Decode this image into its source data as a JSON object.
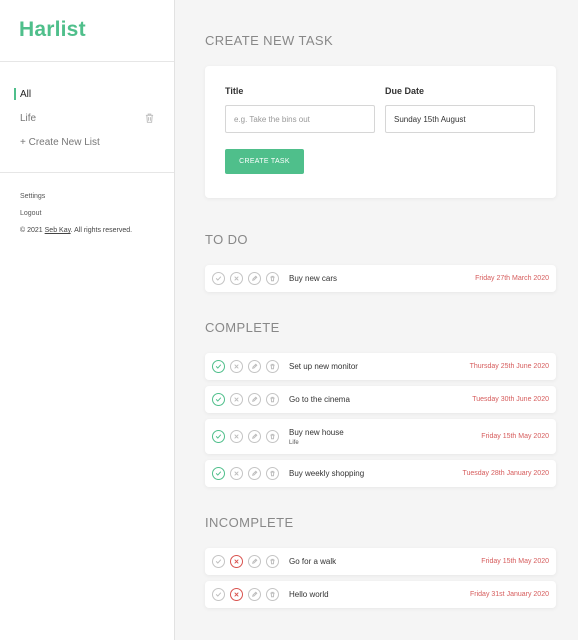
{
  "app": {
    "name": "Harlist"
  },
  "sidebar": {
    "lists": [
      {
        "label": "All",
        "active": true,
        "deletable": false
      },
      {
        "label": "Life",
        "active": false,
        "deletable": true
      }
    ],
    "new_list_label": "+ Create New List",
    "settings_label": "Settings",
    "logout_label": "Logout",
    "copyright_prefix": "© 2021",
    "copyright_author": "Seb Kay",
    "copyright_suffix": ". All rights reserved."
  },
  "create": {
    "heading": "CREATE NEW TASK",
    "title_label": "Title",
    "title_placeholder": "e.g. Take the bins out",
    "date_label": "Due Date",
    "date_value": "Sunday 15th August",
    "button_label": "CREATE TASK"
  },
  "groups": [
    {
      "heading": "TO DO",
      "status": "todo",
      "tasks": [
        {
          "name": "Buy new cars",
          "list": "",
          "date": "Friday 27th March 2020"
        }
      ]
    },
    {
      "heading": "COMPLETE",
      "status": "complete",
      "tasks": [
        {
          "name": "Set up new monitor",
          "list": "",
          "date": "Thursday 25th June 2020"
        },
        {
          "name": "Go to the cinema",
          "list": "",
          "date": "Tuesday 30th June 2020"
        },
        {
          "name": "Buy new house",
          "list": "Life",
          "date": "Friday 15th May 2020"
        },
        {
          "name": "Buy weekly shopping",
          "list": "",
          "date": "Tuesday 28th January 2020"
        }
      ]
    },
    {
      "heading": "INCOMPLETE",
      "status": "incomplete",
      "tasks": [
        {
          "name": "Go for a walk",
          "list": "",
          "date": "Friday 15th May 2020"
        },
        {
          "name": "Hello world",
          "list": "",
          "date": "Friday 31st January 2020"
        }
      ]
    }
  ],
  "colors": {
    "accent": "#4fbf8b",
    "date": "#d65c5c",
    "incomplete": "#d9534f",
    "icon_neutral": "#c4c4c4"
  },
  "icons": {
    "complete": "check-icon",
    "incomplete": "cross-icon",
    "edit": "pencil-icon",
    "delete": "trash-icon"
  }
}
